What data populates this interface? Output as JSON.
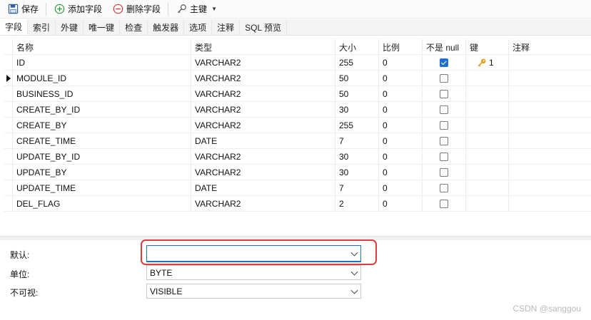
{
  "toolbar": {
    "save_label": "保存",
    "add_field_label": "添加字段",
    "delete_field_label": "删除字段",
    "primary_key_label": "主键"
  },
  "tabs": [
    {
      "label": "字段",
      "active": true
    },
    {
      "label": "索引",
      "active": false
    },
    {
      "label": "外键",
      "active": false
    },
    {
      "label": "唯一键",
      "active": false
    },
    {
      "label": "检查",
      "active": false
    },
    {
      "label": "触发器",
      "active": false
    },
    {
      "label": "选项",
      "active": false
    },
    {
      "label": "注释",
      "active": false
    },
    {
      "label": "SQL 预览",
      "active": false
    }
  ],
  "grid": {
    "columns": [
      "名称",
      "类型",
      "大小",
      "比例",
      "不是 null",
      "键",
      "注释"
    ],
    "rows": [
      {
        "name": "ID",
        "type": "VARCHAR2",
        "size": "255",
        "scale": "0",
        "not_null": true,
        "key": "1",
        "comment": "",
        "current": false
      },
      {
        "name": "MODULE_ID",
        "type": "VARCHAR2",
        "size": "50",
        "scale": "0",
        "not_null": false,
        "key": "",
        "comment": "",
        "current": true
      },
      {
        "name": "BUSINESS_ID",
        "type": "VARCHAR2",
        "size": "50",
        "scale": "0",
        "not_null": false,
        "key": "",
        "comment": "",
        "current": false
      },
      {
        "name": "CREATE_BY_ID",
        "type": "VARCHAR2",
        "size": "30",
        "scale": "0",
        "not_null": false,
        "key": "",
        "comment": "",
        "current": false
      },
      {
        "name": "CREATE_BY",
        "type": "VARCHAR2",
        "size": "255",
        "scale": "0",
        "not_null": false,
        "key": "",
        "comment": "",
        "current": false
      },
      {
        "name": "CREATE_TIME",
        "type": "DATE",
        "size": "7",
        "scale": "0",
        "not_null": false,
        "key": "",
        "comment": "",
        "current": false
      },
      {
        "name": "UPDATE_BY_ID",
        "type": "VARCHAR2",
        "size": "30",
        "scale": "0",
        "not_null": false,
        "key": "",
        "comment": "",
        "current": false
      },
      {
        "name": "UPDATE_BY",
        "type": "VARCHAR2",
        "size": "30",
        "scale": "0",
        "not_null": false,
        "key": "",
        "comment": "",
        "current": false
      },
      {
        "name": "UPDATE_TIME",
        "type": "DATE",
        "size": "7",
        "scale": "0",
        "not_null": false,
        "key": "",
        "comment": "",
        "current": false
      },
      {
        "name": "DEL_FLAG",
        "type": "VARCHAR2",
        "size": "2",
        "scale": "0",
        "not_null": false,
        "key": "",
        "comment": "",
        "current": false
      }
    ]
  },
  "properties": {
    "default_label": "默认:",
    "default_value": "",
    "unit_label": "单位:",
    "unit_value": "BYTE",
    "visibility_label": "不可视:",
    "visibility_value": "VISIBLE"
  },
  "watermark": "CSDN @sanggou",
  "colors": {
    "accent": "#1f6fd1",
    "highlight": "#e03a3a",
    "add_icon": "#2e9a3a",
    "delete_icon": "#d13a3a",
    "key_icon": "#e0a020"
  },
  "icons": {
    "save": "save-icon",
    "add": "add-circle-icon",
    "delete": "remove-circle-icon",
    "key": "key-icon",
    "row_marker": "current-row-arrow-icon",
    "combo_arrow": "chevron-down-icon"
  }
}
